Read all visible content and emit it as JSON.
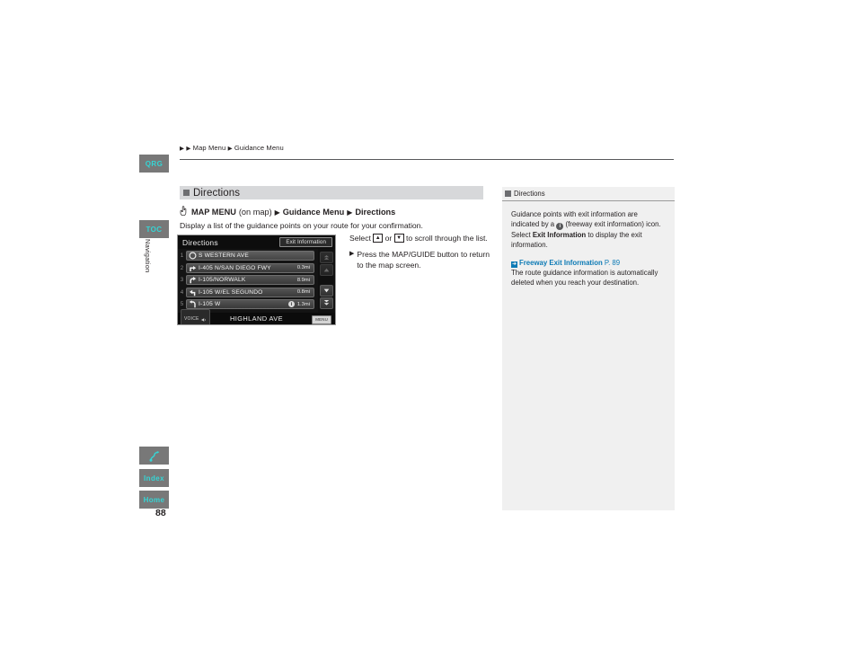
{
  "page": {
    "number": "88",
    "breadcrumb": "Map Menu Guidance Menu",
    "breadcrumb_parts": [
      "Map Menu",
      "Guidance Menu"
    ]
  },
  "rail": {
    "tabs": [
      {
        "id": "qrg",
        "label": "QRG"
      },
      {
        "id": "toc",
        "label": "TOC"
      },
      {
        "id": "route",
        "label": "",
        "icon": "route-icon"
      },
      {
        "id": "index",
        "label": "Index"
      },
      {
        "id": "home",
        "label": "Home"
      }
    ],
    "vertical_label": "Navigation",
    "tab_bg": "#787878",
    "tab_fg": "#35d5d5"
  },
  "section": {
    "title": "Directions",
    "menu_path": {
      "icon": "hand-press-icon",
      "first": "MAP MENU",
      "first_note": "(on map)",
      "second": "Guidance Menu",
      "third": "Directions"
    },
    "intro": "Display a list of the guidance points on your route for your confirmation."
  },
  "nav_screen": {
    "title": "Directions",
    "exit_info_button": "Exit Information",
    "rows": [
      {
        "num": "1",
        "icon": "circle-start-icon",
        "label": "S WESTERN AVE",
        "distance": "",
        "info": false
      },
      {
        "num": "2",
        "icon": "turn-right-icon",
        "label": "I-405 N/SAN DIEGO FWY",
        "distance": "0.3mi",
        "info": false
      },
      {
        "num": "3",
        "icon": "curve-right-icon",
        "label": "I-105/NORWALK",
        "distance": "8.9mi",
        "info": false
      },
      {
        "num": "4",
        "icon": "turn-left-icon",
        "label": "I-105 W/EL SEGUNDO",
        "distance": "0.8mi",
        "info": false
      },
      {
        "num": "5",
        "icon": "uturn-left-icon",
        "label": "I-105 W",
        "distance": "1.3mi",
        "info": true
      }
    ],
    "scroll_buttons": [
      {
        "id": "page-up",
        "icon": "double-up-icon",
        "state": "dim"
      },
      {
        "id": "up",
        "icon": "up-arrow-icon",
        "state": "dim"
      },
      {
        "id": "down",
        "icon": "down-arrow-icon",
        "state": "active"
      },
      {
        "id": "page-down",
        "icon": "double-down-icon",
        "state": "active"
      }
    ],
    "bottom_bar": {
      "voice_label": "VOICE",
      "voice_icon": "speaker-icon",
      "street_name": "HIGHLAND AVE",
      "menu_chip": "MENU"
    }
  },
  "instructions": {
    "scroll_line_pre": "Select",
    "key_up": "▲",
    "scroll_line_mid": "or",
    "key_down": "▼",
    "scroll_line_post": "to scroll through the list.",
    "bullet": "Press the MAP/GUIDE button to return to the map screen."
  },
  "notes": {
    "header": "Directions",
    "paragraph_1_pre": "Guidance points with exit information are indicated by a",
    "paragraph_1_mid": "(freeway exit information) icon. Select",
    "paragraph_1_bold": "Exit Information",
    "paragraph_1_post": "to display the exit information.",
    "xref_label": "Freeway Exit Information",
    "xref_page": "P. 89",
    "paragraph_2": "The route guidance information is automatically deleted when you reach your destination.",
    "accent_color": "#0c7ab5",
    "panel_bg": "#f0f0f0"
  }
}
